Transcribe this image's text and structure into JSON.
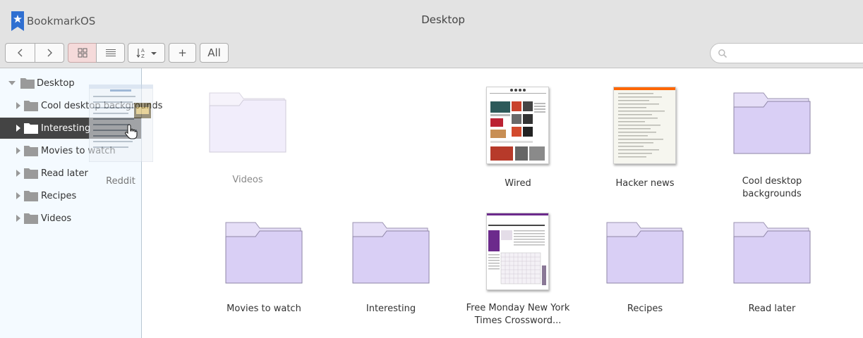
{
  "app": {
    "name": "BookmarkOS"
  },
  "window": {
    "title": "Desktop"
  },
  "toolbar": {
    "back_icon": "chevron-left-icon",
    "forward_icon": "chevron-right-icon",
    "grid_view_icon": "grid-icon",
    "list_view_icon": "list-icon",
    "sort_icon": "sort-az-icon",
    "add_label": "+",
    "all_label": "All",
    "search_placeholder": ""
  },
  "sidebar": {
    "root": {
      "label": "Desktop",
      "expanded": true
    },
    "items": [
      {
        "label": "Cool desktop backgrounds",
        "selected": false
      },
      {
        "label": "Interesting",
        "selected": true
      },
      {
        "label": "Movies to watch",
        "selected": false
      },
      {
        "label": "Read later",
        "selected": false
      },
      {
        "label": "Recipes",
        "selected": false
      },
      {
        "label": "Videos",
        "selected": false
      }
    ]
  },
  "drag": {
    "label": "Reddit"
  },
  "grid": {
    "items": [
      {
        "label": "Videos",
        "type": "folder",
        "state": "faded"
      },
      {
        "label": "Wired",
        "type": "bookmark"
      },
      {
        "label": "Hacker news",
        "type": "bookmark"
      },
      {
        "label": "Cool desktop backgrounds",
        "type": "folder"
      },
      {
        "label": "Movies to watch",
        "type": "folder"
      },
      {
        "label": "Interesting",
        "type": "folder"
      },
      {
        "label": "Free Monday New York Times Crossword...",
        "type": "bookmark"
      },
      {
        "label": "Recipes",
        "type": "folder"
      },
      {
        "label": "Read later",
        "type": "folder"
      }
    ]
  },
  "colors": {
    "folder_fill": "#d9cff5",
    "folder_stroke": "#9b93b1",
    "selected_row": "#444444",
    "sidebar_bg": "#f4faff",
    "active_button": "#f5dada",
    "logo": "#2f6fd1"
  }
}
